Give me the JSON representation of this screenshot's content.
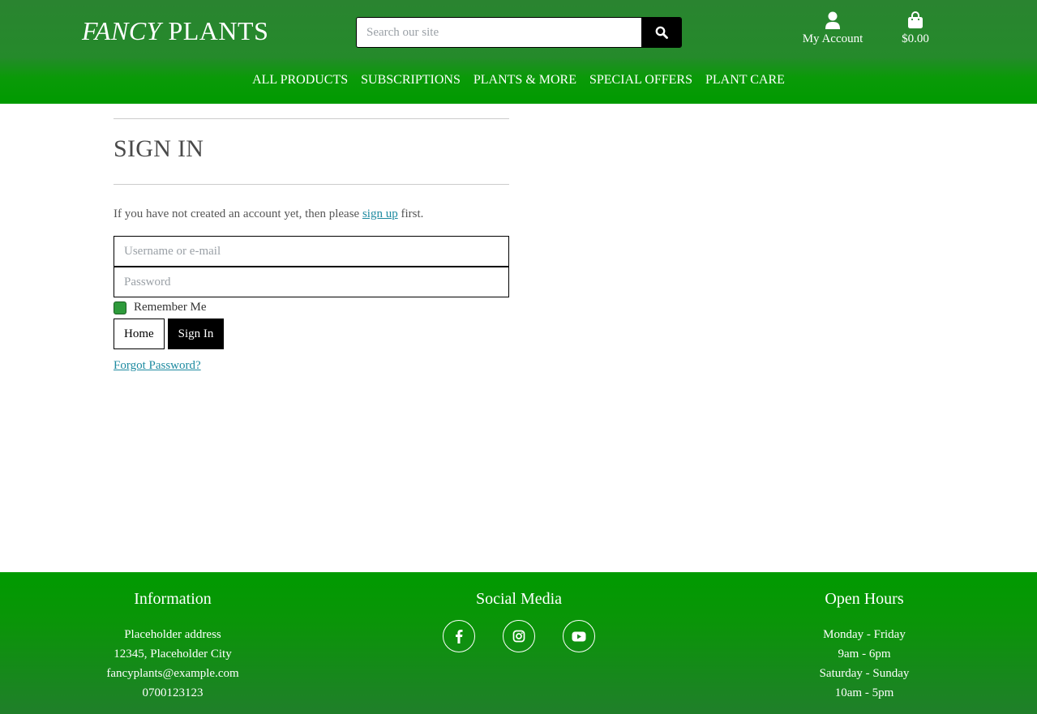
{
  "header": {
    "logo_part1": "FANCY",
    "logo_part2": " PLANTS",
    "search_placeholder": "Search our site",
    "account_label": "My Account",
    "cart_total": "$0.00"
  },
  "nav": {
    "items": [
      "ALL PRODUCTS",
      "SUBSCRIPTIONS",
      "PLANTS & MORE",
      "SPECIAL OFFERS",
      "PLANT CARE"
    ]
  },
  "signin": {
    "title": "SIGN IN",
    "note_prefix": "If you have not created an account yet, then please ",
    "signup_link": "sign up",
    "note_suffix": " first.",
    "username_placeholder": "Username or e-mail",
    "password_placeholder": "Password",
    "remember_label": "Remember Me",
    "home_button": "Home",
    "signin_button": "Sign In",
    "forgot_link": "Forgot Password?"
  },
  "footer": {
    "info": {
      "heading": "Information",
      "lines": [
        "Placeholder address",
        "12345, Placeholder City",
        "fancyplants@example.com",
        "0700123123"
      ]
    },
    "social": {
      "heading": "Social Media",
      "icons": [
        "facebook-icon",
        "instagram-icon",
        "youtube-icon"
      ]
    },
    "hours": {
      "heading": "Open Hours",
      "lines": [
        "Monday - Friday",
        "9am - 6pm",
        "Saturday - Sunday",
        "10am - 5pm"
      ]
    }
  },
  "colors": {
    "header_green": "#258a2b",
    "nav_green": "#009a00",
    "link": "#1d8aa0",
    "checkbox": "#2e9a3b"
  }
}
